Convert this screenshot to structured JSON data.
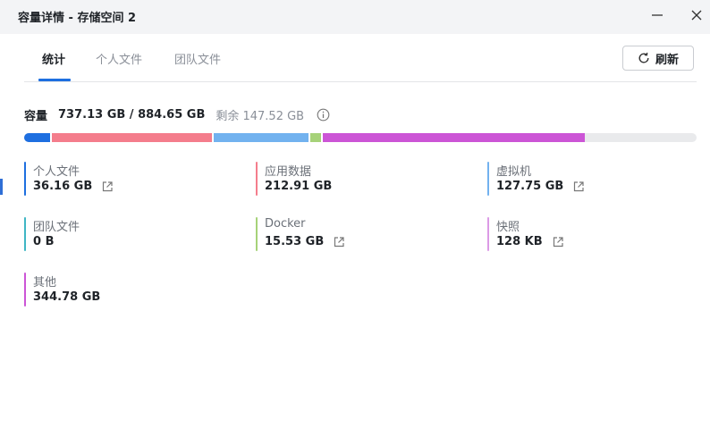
{
  "window": {
    "title": "容量详情 - 存储空间 2"
  },
  "tabs": [
    {
      "label": "统计",
      "active": true
    },
    {
      "label": "个人文件",
      "active": false
    },
    {
      "label": "团队文件",
      "active": false
    }
  ],
  "toolbar": {
    "refresh_label": "刷新",
    "refresh_icon": "refresh-icon"
  },
  "capacity": {
    "label": "容量",
    "used_total": "737.13 GB / 884.65 GB",
    "remaining": "剩余 147.52 GB",
    "info_icon": "info-icon"
  },
  "usage_bar": {
    "background_color": "#e9eaec",
    "total_gb": 884.65,
    "segments": [
      {
        "name": "个人文件",
        "gb": 36.16,
        "color": "#1e6fe0"
      },
      {
        "name": "应用数据",
        "gb": 212.91,
        "color": "#f47d8c"
      },
      {
        "name": "虚拟机",
        "gb": 127.75,
        "color": "#72b2ef"
      },
      {
        "name": "Docker",
        "gb": 15.53,
        "color": "#a6d279"
      },
      {
        "name": "其他",
        "gb": 344.78,
        "color": "#cc55d6"
      }
    ]
  },
  "items": [
    {
      "name": "个人文件",
      "value": "36.16 GB",
      "color": "#1e6fe0",
      "has_link": true
    },
    {
      "name": "应用数据",
      "value": "212.91 GB",
      "color": "#f47d8c",
      "has_link": false
    },
    {
      "name": "虚拟机",
      "value": "127.75 GB",
      "color": "#72b2ef",
      "has_link": true
    },
    {
      "name": "团队文件",
      "value": "0 B",
      "color": "#3fb6c4",
      "has_link": false
    },
    {
      "name": "Docker",
      "value": "15.53 GB",
      "color": "#a6d279",
      "has_link": true
    },
    {
      "name": "快照",
      "value": "128 KB",
      "color": "#dc9ae6",
      "has_link": true
    },
    {
      "name": "其他",
      "value": "344.78 GB",
      "color": "#cc55d6",
      "has_link": false
    }
  ]
}
